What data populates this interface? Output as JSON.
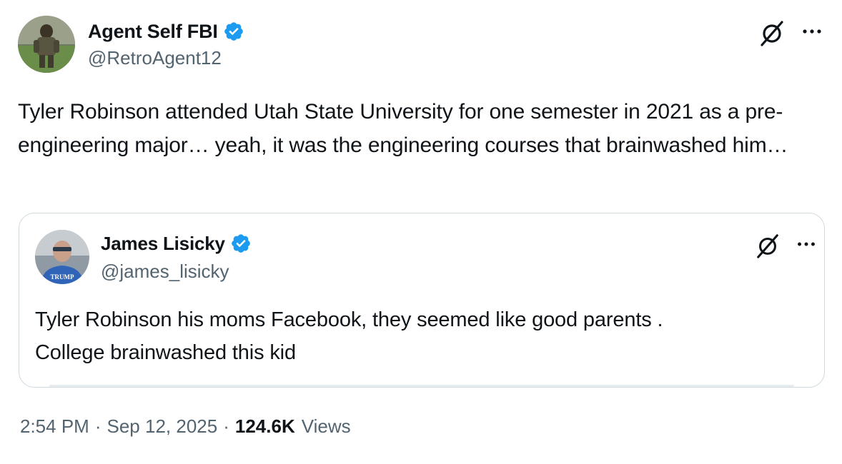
{
  "author": {
    "display_name": "Agent Self FBI",
    "handle": "@RetroAgent12",
    "verified": true
  },
  "tweet": {
    "text": "Tyler Robinson attended Utah State University for one semester in 2021 as a pre-engineering major… yeah, it was the engineering courses that brainwashed him…"
  },
  "quoted_tweet": {
    "display_name": "James Lisicky",
    "handle": "@james_lisicky",
    "verified": true,
    "avatar_shirt_text": "TRUMP",
    "text_line1": "Tyler Robinson his moms Facebook, they seemed like good parents .",
    "text_line2": "College brainwashed this kid"
  },
  "meta": {
    "time": "2:54 PM",
    "separator": "·",
    "date": "Sep 12, 2025",
    "views_count": "124.6K",
    "views_label": "Views"
  },
  "icons": {
    "verified": "verified-badge-icon",
    "grok": "grok-icon",
    "more": "more-options-icon"
  },
  "colors": {
    "verified_blue": "#1d9bf0",
    "secondary_text": "#536471",
    "border": "#cfd9de"
  }
}
